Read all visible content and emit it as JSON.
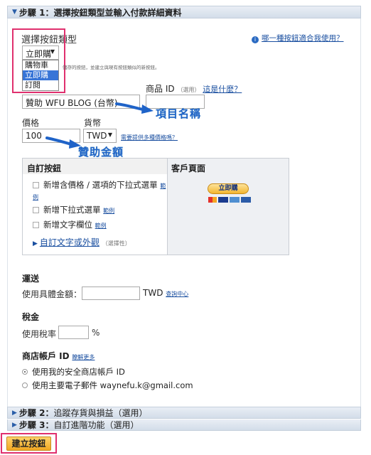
{
  "step1": {
    "title": "步驟 1：選擇按鈕類型並輸入付款詳細資料"
  },
  "button_type": {
    "label": "選擇按鈕類型",
    "selected": "立即購",
    "options": [
      "購物車",
      "立即購",
      "訂閱"
    ],
    "hint_text": "儲存的按鈕，並建立與現有按鈕類似的新按鈕。"
  },
  "help_link": "哪一種按鈕適合我使用？",
  "item_name": {
    "value": "贊助 WFU BLOG (台幣)"
  },
  "product_id": {
    "label": "商品 ID",
    "optional": "（選用）",
    "what_link": "這是什麼？"
  },
  "price": {
    "label": "價格",
    "value": "100"
  },
  "currency": {
    "label": "貨幣",
    "value": "TWD",
    "link": "需要提供多種價格嗎？"
  },
  "annotations": {
    "item_name": "項目名稱",
    "amount": "贊助金額"
  },
  "custom": {
    "title": "自訂按鈕",
    "options": [
      {
        "text": "新增含價格 / 選項的下拉式選單",
        "example": "範例"
      },
      {
        "text": "新增下拉式選單",
        "example": "範例"
      },
      {
        "text": "新增文字欄位",
        "example": "範例"
      }
    ],
    "customize_link": "自訂文字或外觀",
    "optional": "（選擇性）"
  },
  "preview": {
    "title": "客戶頁面",
    "button_label": "立即購"
  },
  "shipping": {
    "title": "運送",
    "label": "使用具體金額：",
    "unit": "TWD",
    "link": "查詢中心"
  },
  "tax": {
    "title": "稅金",
    "label": "使用稅率",
    "unit": "%"
  },
  "merchant": {
    "title": "商店帳戶 ID",
    "more": "瞭解更多",
    "opt1": "使用我的安全商店帳戶 ID",
    "opt2": "使用主要電子郵件 waynefu.k@gmail.com"
  },
  "step2": {
    "title": "步驟 2：",
    "sub": "追蹤存貨與損益（選用）"
  },
  "step3": {
    "title": "步驟 3：",
    "sub": "自訂進階功能（選用）"
  },
  "create_button": "建立按鈕",
  "colors": {
    "highlight": "#e0306e",
    "annotation": "#1f63c8",
    "paypal_gold": "#f6c34a"
  }
}
